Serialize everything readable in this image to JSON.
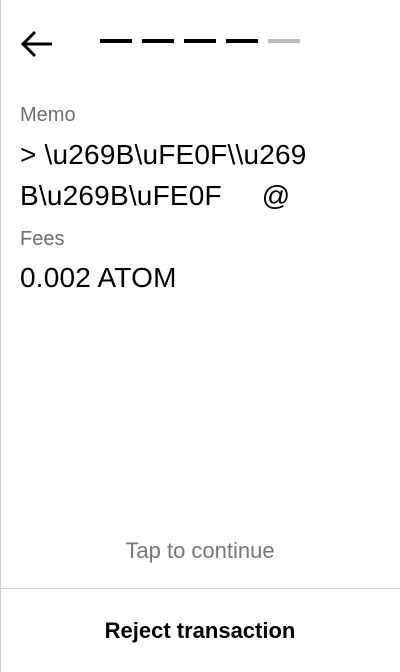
{
  "header": {
    "back_icon": "arrow-left-icon",
    "progress": {
      "total_steps": 5,
      "completed_steps": 4,
      "active_color": "#000000",
      "inactive_color": "#bdbdbd"
    }
  },
  "memo": {
    "label": "Memo",
    "line1": "> \\u269B\\uFE0F\\\\u269",
    "line2": "B\\u269B\\uFE0F     @"
  },
  "fees": {
    "label": "Fees",
    "value": "0.002 ATOM"
  },
  "footer": {
    "tap_text": "Tap to continue",
    "reject_label": "Reject transaction"
  }
}
